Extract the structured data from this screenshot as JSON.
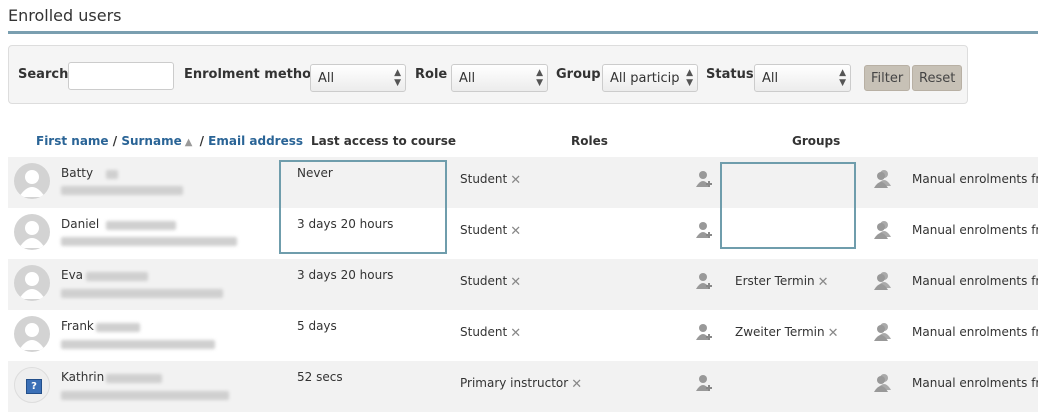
{
  "page": {
    "title": "Enrolled users"
  },
  "filters": {
    "search_label": "Search",
    "search_value": "",
    "enrol_label": "Enrolment methods",
    "enrol_value": "All",
    "role_label": "Role",
    "role_value": "All",
    "group_label": "Group",
    "group_value": "All particip",
    "status_label": "Status",
    "status_value": "All",
    "filter_button": "Filter",
    "reset_button": "Reset"
  },
  "table": {
    "col_firstname": "First name",
    "col_sep1": " / ",
    "col_surname": "Surname",
    "col_sep2": " / ",
    "col_email": "Email address",
    "col_access": "Last access to course",
    "col_roles": "Roles",
    "col_groups": "Groups",
    "rows": [
      {
        "first_name": "Batty",
        "last_access": "Never",
        "role": "Student",
        "group": "",
        "method": "Manual enrolments fro"
      },
      {
        "first_name": "Daniel",
        "last_access": "3 days 20 hours",
        "role": "Student",
        "group": "",
        "method": "Manual enrolments fro"
      },
      {
        "first_name": "Eva",
        "last_access": "3 days 20 hours",
        "role": "Student",
        "group": "Erster Termin",
        "method": "Manual enrolments fro"
      },
      {
        "first_name": "Frank",
        "last_access": "5 days",
        "role": "Student",
        "group": "Zweiter Termin",
        "method": "Manual enrolments fro"
      },
      {
        "first_name": "Kathrin",
        "last_access": "52 secs",
        "role": "Primary instructor",
        "group": "",
        "method": "Manual enrolments fro"
      }
    ]
  },
  "icons": {
    "avatar": "user-silhouette-icon",
    "remove": "x-icon",
    "assign_role": "add-user-icon",
    "assign_group": "user-group-icon",
    "help": "question-icon"
  },
  "colors": {
    "accent": "#7a9fb0",
    "link": "#2a6496",
    "row_alt": "#f2f2f2",
    "button": "#c7c1b6"
  }
}
